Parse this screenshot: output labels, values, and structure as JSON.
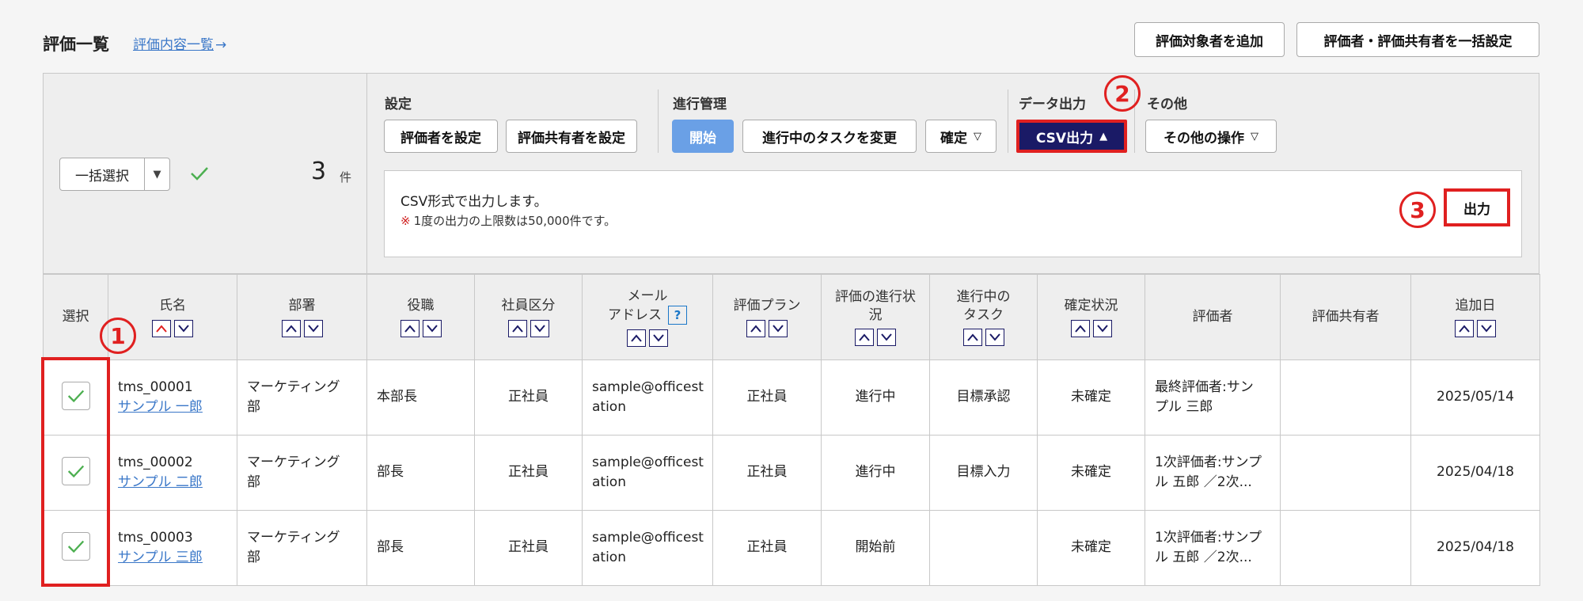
{
  "header": {
    "title": "評価一覧",
    "link_label": "評価内容一覧",
    "link_arrow": "→",
    "add_target_label": "評価対象者を追加",
    "bulk_set_label": "評価者・評価共有者を一括設定"
  },
  "panel": {
    "bulk_select_label": "一括選択",
    "count": "3",
    "count_unit": "件",
    "groups": {
      "settings": "設定",
      "progress": "進行管理",
      "data_output": "データ出力",
      "other": "その他"
    },
    "buttons": {
      "set_evaluator": "評価者を設定",
      "set_sharer": "評価共有者を設定",
      "start": "開始",
      "change_task": "進行中のタスクを変更",
      "confirm": "確定",
      "csv_output": "CSV出力",
      "other_ops": "その他の操作"
    },
    "info": {
      "line1": "CSV形式で出力します。",
      "mark": "※",
      "line2": "1度の出力の上限数は50,000件です。",
      "output_label": "出力"
    }
  },
  "annotations": [
    "1",
    "2",
    "3"
  ],
  "table": {
    "headers": {
      "select": "選択",
      "name": "氏名",
      "dept": "部署",
      "position": "役職",
      "emp_type": "社員区分",
      "email_1": "メール",
      "email_2": "アドレス",
      "help": "?",
      "plan": "評価プラン",
      "progress_1": "評価の進行状",
      "progress_2": "況",
      "task_1": "進行中の",
      "task_2": "タスク",
      "confirm_status": "確定状況",
      "evaluator": "評価者",
      "sharer": "評価共有者",
      "added": "追加日"
    },
    "rows": [
      {
        "id": "tms_00001",
        "name": "サンプル 一郎",
        "dept_1": "マーケティング",
        "dept_2": "部",
        "position": "本部長",
        "emp_type": "正社員",
        "email_1": "sample@officest",
        "email_2": "ation",
        "plan": "正社員",
        "progress": "進行中",
        "task": "目標承認",
        "confirm": "未確定",
        "evaluator_1": "最終評価者:サン",
        "evaluator_2": "プル 三郎",
        "sharer": "",
        "added": "2025/05/14"
      },
      {
        "id": "tms_00002",
        "name": "サンプル 二郎",
        "dept_1": "マーケティング",
        "dept_2": "部",
        "position": "部長",
        "emp_type": "正社員",
        "email_1": "sample@officest",
        "email_2": "ation",
        "plan": "正社員",
        "progress": "進行中",
        "task": "目標入力",
        "confirm": "未確定",
        "evaluator_1": "1次評価者:サンプ",
        "evaluator_2": "ル 五郎 ／2次...",
        "sharer": "",
        "added": "2025/04/18"
      },
      {
        "id": "tms_00003",
        "name": "サンプル 三郎",
        "dept_1": "マーケティング",
        "dept_2": "部",
        "position": "部長",
        "emp_type": "正社員",
        "email_1": "sample@officest",
        "email_2": "ation",
        "plan": "正社員",
        "progress": "開始前",
        "task": "",
        "confirm": "未確定",
        "evaluator_1": "1次評価者:サンプ",
        "evaluator_2": "ル 五郎 ／2次...",
        "sharer": "",
        "added": "2025/04/18"
      }
    ]
  },
  "colors": {
    "accent_navy": "#1a1a66",
    "highlight_red": "#e02020",
    "link_blue": "#3a77c8",
    "check_green": "#4caf50",
    "start_blue": "#6aa0e6"
  }
}
